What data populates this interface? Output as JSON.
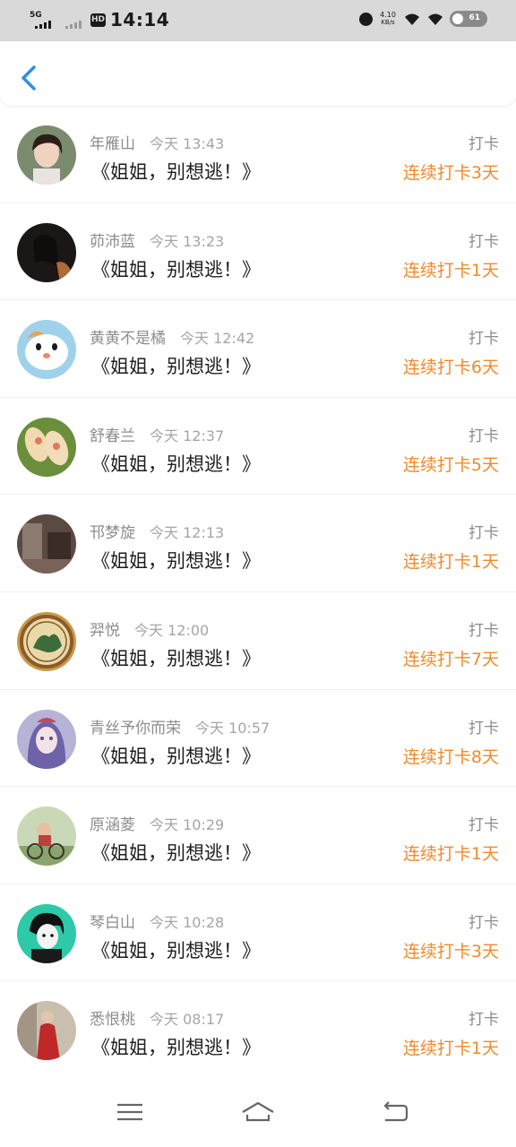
{
  "status_bar": {
    "network": "5G",
    "hd": "HD",
    "time": "14:14",
    "speed_value": "4.10",
    "speed_unit": "KB/s",
    "battery": "61"
  },
  "header": {
    "back_icon": "chevron-left-icon",
    "accent_color": "#2e8fe0"
  },
  "colors": {
    "streak": "#f08a2c",
    "name": "#8c8c8c",
    "title": "#1e1e1e"
  },
  "items": [
    {
      "name": "年雁山",
      "time": "今天 13:43",
      "title": "《姐姐，别想逃！》",
      "tag": "打卡",
      "streak": "连续打卡3天",
      "avatar": "woman-portrait"
    },
    {
      "name": "茆沛蓝",
      "time": "今天 13:23",
      "title": "《姐姐，别想逃！》",
      "tag": "打卡",
      "streak": "连续打卡1天",
      "avatar": "dark-portrait"
    },
    {
      "name": "黄黄不是橘",
      "time": "今天 12:42",
      "title": "《姐姐，别想逃！》",
      "tag": "打卡",
      "streak": "连续打卡6天",
      "avatar": "hamster-cartoon"
    },
    {
      "name": "舒春兰",
      "time": "今天 12:37",
      "title": "《姐姐，别想逃！》",
      "tag": "打卡",
      "streak": "连续打卡5天",
      "avatar": "spring-rolls-food"
    },
    {
      "name": "邗梦旋",
      "time": "今天 12:13",
      "title": "《姐姐，别想逃！》",
      "tag": "打卡",
      "streak": "连续打卡1天",
      "avatar": "room-photo"
    },
    {
      "name": "羿悦",
      "time": "今天 12:00",
      "title": "《姐姐，别想逃！》",
      "tag": "打卡",
      "streak": "连续打卡7天",
      "avatar": "badge-emblem"
    },
    {
      "name": "青丝予你而荣",
      "time": "今天 10:57",
      "title": "《姐姐，别想逃！》",
      "tag": "打卡",
      "streak": "连续打卡8天",
      "avatar": "anime-girl"
    },
    {
      "name": "原涵菱",
      "time": "今天 10:29",
      "title": "《姐姐，别想逃！》",
      "tag": "打卡",
      "streak": "连续打卡1天",
      "avatar": "cartoon-bicycle"
    },
    {
      "name": "琴白山",
      "time": "今天 10:28",
      "title": "《姐姐，别想逃！》",
      "tag": "打卡",
      "streak": "连续打卡3天",
      "avatar": "anime-boy"
    },
    {
      "name": "悉恨桃",
      "time": "今天 08:17",
      "title": "《姐姐，别想逃！》",
      "tag": "打卡",
      "streak": "连续打卡1天",
      "avatar": "red-dress-photo"
    }
  ],
  "navbar": {
    "menu_icon": "menu-icon",
    "home_icon": "home-icon",
    "back_icon": "back-icon"
  }
}
